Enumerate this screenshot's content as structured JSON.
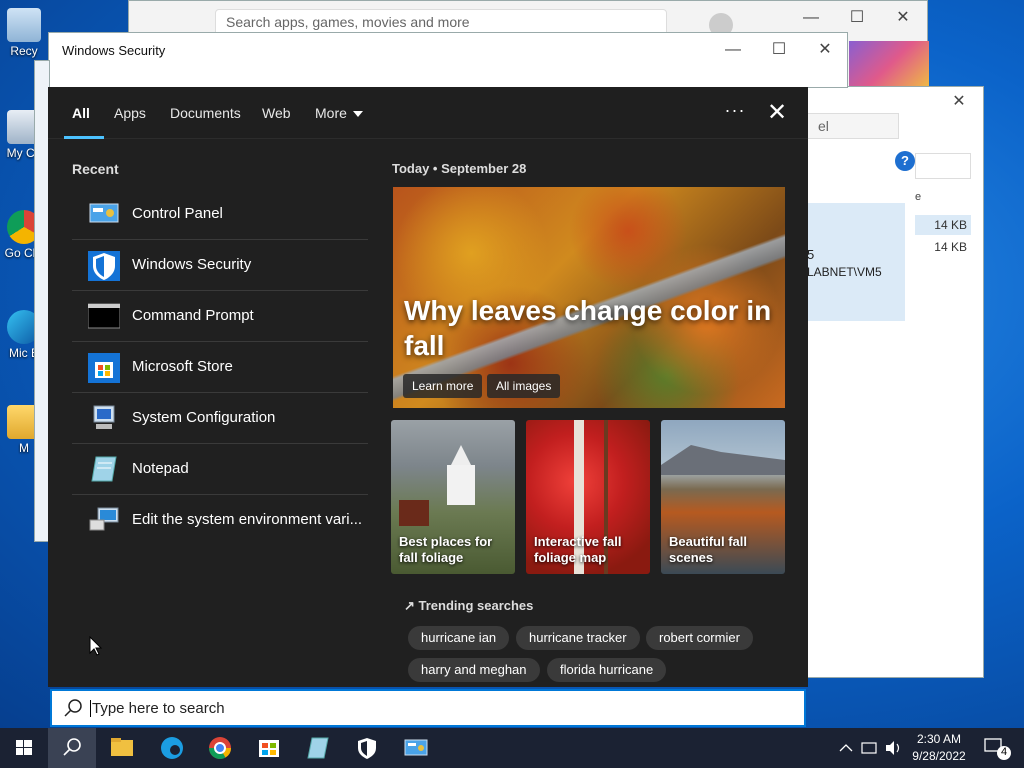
{
  "desktop": {
    "icons": [
      {
        "label": "Recy"
      },
      {
        "label": "My Co"
      },
      {
        "label": "Go Chr"
      },
      {
        "label": "Mic E"
      },
      {
        "label": "M"
      }
    ]
  },
  "bg_windows": {
    "store": {
      "search_placeholder": "Search apps, games, movies and more"
    },
    "security": {
      "title": "Windows Security"
    },
    "explorer": {
      "search_text": "el",
      "file_sizes": [
        "14 KB",
        "14 KB"
      ],
      "col_header": "e",
      "user_text": "5",
      "owner_text": "LABNET\\VM5"
    }
  },
  "search_panel": {
    "tabs": [
      {
        "label": "All"
      },
      {
        "label": "Apps"
      },
      {
        "label": "Documents"
      },
      {
        "label": "Web"
      },
      {
        "label": "More"
      }
    ],
    "more_icon": "chevron-down-icon",
    "dots_label": "···",
    "close_label": "✕",
    "recent_title": "Recent",
    "recent_items": [
      {
        "label": "Control Panel",
        "icon": "control-panel-icon"
      },
      {
        "label": "Windows Security",
        "icon": "shield-icon"
      },
      {
        "label": "Command Prompt",
        "icon": "terminal-icon"
      },
      {
        "label": "Microsoft Store",
        "icon": "store-icon"
      },
      {
        "label": "System Configuration",
        "icon": "system-config-icon"
      },
      {
        "label": "Notepad",
        "icon": "notepad-icon"
      },
      {
        "label": "Edit the system environment vari...",
        "icon": "system-env-icon"
      }
    ],
    "today_label": "Today  •  September 28",
    "hero": {
      "title": "Why leaves change color in fall",
      "learn_more": "Learn more",
      "all_images": "All images"
    },
    "cards": [
      {
        "caption": "Best places for fall foliage"
      },
      {
        "caption": "Interactive fall foliage map"
      },
      {
        "caption": "Beautiful fall scenes"
      }
    ],
    "trending_title": "↗ Trending searches",
    "trending": [
      "hurricane ian",
      "hurricane tracker",
      "robert cormier",
      "harry and meghan",
      "florida hurricane"
    ]
  },
  "searchbox": {
    "placeholder": "Type here to search"
  },
  "taskbar": {
    "apps": [
      "file-explorer-icon",
      "edge-icon",
      "chrome-icon",
      "store-icon",
      "notepad-icon",
      "shield-icon",
      "control-panel-icon"
    ],
    "time": "2:30 AM",
    "date": "9/28/2022",
    "notification_count": "4"
  },
  "colors": {
    "accent": "#4cc2ff",
    "panel_bg": "#202020",
    "taskbar_bg": "#1b2233",
    "search_border": "#0078d7"
  }
}
